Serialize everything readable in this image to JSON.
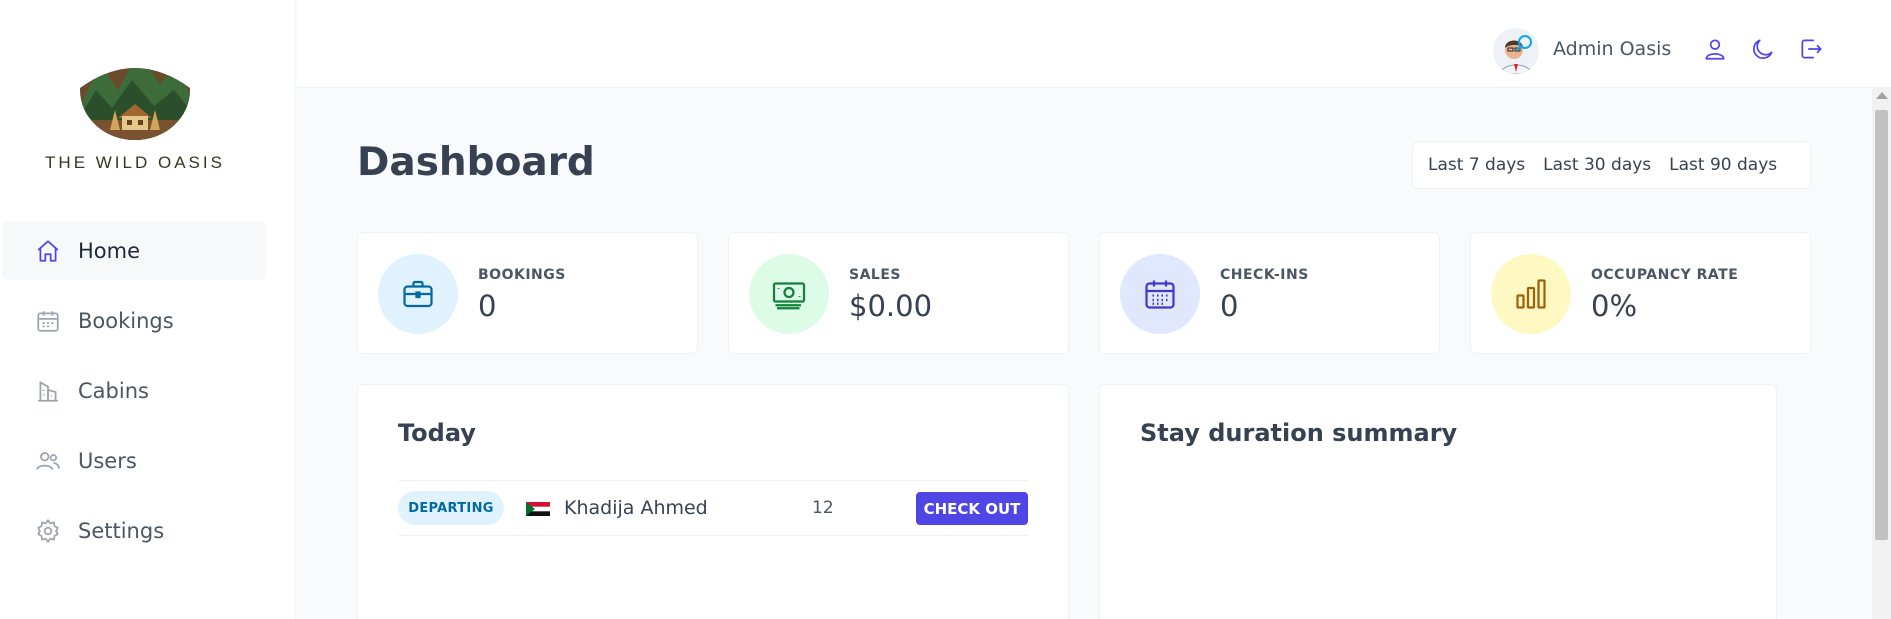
{
  "sidebar": {
    "brand": "THE WILD OASIS",
    "items": [
      {
        "label": "Home",
        "icon": "home-icon",
        "active": true
      },
      {
        "label": "Bookings",
        "icon": "calendar-icon"
      },
      {
        "label": "Cabins",
        "icon": "building-icon"
      },
      {
        "label": "Users",
        "icon": "users-icon"
      },
      {
        "label": "Settings",
        "icon": "gear-icon"
      }
    ]
  },
  "header": {
    "username": "Admin Oasis",
    "icons": [
      "user-icon",
      "moon-icon",
      "logout-icon"
    ]
  },
  "main": {
    "title": "Dashboard",
    "filters": [
      "Last 7 days",
      "Last 30 days",
      "Last 90 days"
    ],
    "stats": [
      {
        "label": "BOOKINGS",
        "value": "0",
        "icon": "briefcase-icon",
        "color": "#0369a1",
        "bg": "#e0f2fe"
      },
      {
        "label": "SALES",
        "value": "$0.00",
        "icon": "banknotes-icon",
        "color": "#15803d",
        "bg": "#dcfce7"
      },
      {
        "label": "CHECK-INS",
        "value": "0",
        "icon": "calendar-days-icon",
        "color": "#4338ca",
        "bg": "#e0e7ff"
      },
      {
        "label": "OCCUPANCY RATE",
        "value": "0%",
        "icon": "chart-bar-icon",
        "color": "#a16207",
        "bg": "#fef9c3"
      }
    ],
    "today": {
      "title": "Today",
      "activities": [
        {
          "status": "DEPARTING",
          "guest": "Khadija Ahmed",
          "nights": "12",
          "action": "CHECK OUT"
        }
      ]
    },
    "duration": {
      "title": "Stay duration summary"
    }
  },
  "colors": {
    "accent": "#4f46e5",
    "background": "#f9fafb"
  }
}
